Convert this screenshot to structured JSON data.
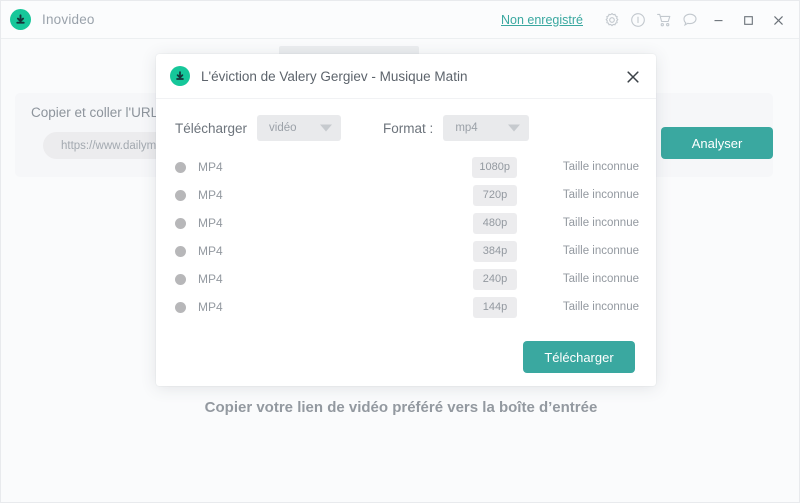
{
  "titlebar": {
    "brand_name": "Inovideo",
    "logo_icon": "download-circle-icon",
    "unsaved_link": "Non enregistré",
    "icons": [
      {
        "name": "gear-icon",
        "label": "Paramètres"
      },
      {
        "name": "info-icon",
        "label": "Informations"
      },
      {
        "name": "cart-icon",
        "label": "Boutique"
      },
      {
        "name": "chat-icon",
        "label": "Assistance"
      }
    ],
    "window_controls": [
      {
        "name": "minimize-button",
        "glyph": "—"
      },
      {
        "name": "maximize-button",
        "glyph": "□"
      },
      {
        "name": "close-button",
        "glyph": "✕"
      }
    ]
  },
  "background": {
    "url_card_label": "Copier et coller l'URL",
    "url_input_value": "https://www.dailymotion",
    "url_input_placeholder": "https://www.dailymotion",
    "analyse_button": "Analyser",
    "hint": "Copier votre lien de vidéo préféré vers la boîte d’entrée"
  },
  "modal": {
    "logo_icon": "download-circle-icon",
    "title": "L'éviction de Valery Gergiev - Musique Matin",
    "close_icon": "close-icon",
    "download_label": "Télécharger",
    "type_select": {
      "value": "vidéo",
      "caret_icon": "chevron-down-icon"
    },
    "format_label": "Format :",
    "format_select": {
      "value": "mp4",
      "caret_icon": "chevron-down-icon"
    },
    "rows": [
      {
        "format": "MP4",
        "quality": "1080p",
        "size": "Taille inconnue"
      },
      {
        "format": "MP4",
        "quality": "720p",
        "size": "Taille inconnue"
      },
      {
        "format": "MP4",
        "quality": "480p",
        "size": "Taille inconnue"
      },
      {
        "format": "MP4",
        "quality": "384p",
        "size": "Taille inconnue"
      },
      {
        "format": "MP4",
        "quality": "240p",
        "size": "Taille inconnue"
      },
      {
        "format": "MP4",
        "quality": "144p",
        "size": "Taille inconnue"
      }
    ],
    "download_button": "Télécharger"
  },
  "colors": {
    "accent": "#3aa8a0",
    "logo_green": "#16c79a",
    "muted_text": "#9399a0",
    "badge_bg": "#ececee"
  }
}
